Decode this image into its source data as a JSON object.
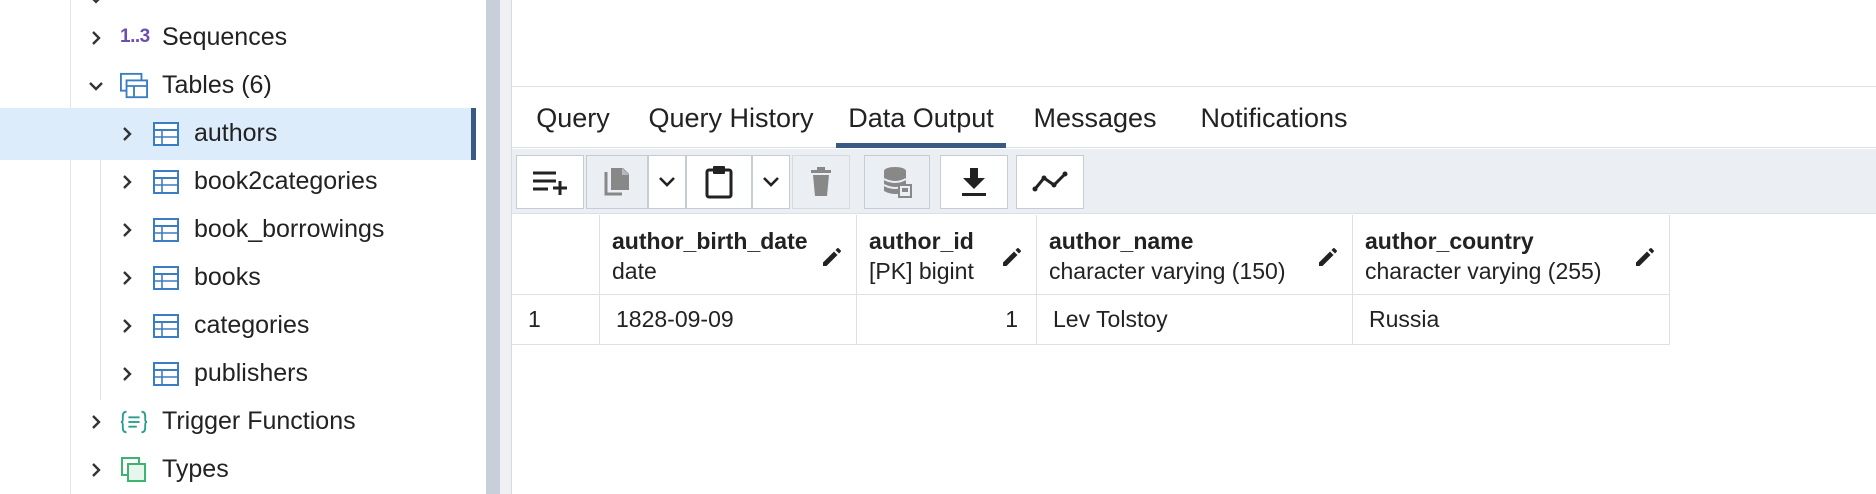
{
  "tree": {
    "items": [
      {
        "label": "Sequences",
        "icon": "sequence-icon",
        "icon_text": "1..3",
        "expanded": false
      },
      {
        "label": "Tables (6)",
        "icon": "tables-icon",
        "expanded": true
      },
      {
        "label": "authors",
        "icon": "table-icon",
        "expanded": false,
        "selected": true
      },
      {
        "label": "book2categories",
        "icon": "table-icon",
        "expanded": false
      },
      {
        "label": "book_borrowings",
        "icon": "table-icon",
        "expanded": false
      },
      {
        "label": "books",
        "icon": "table-icon",
        "expanded": false
      },
      {
        "label": "categories",
        "icon": "table-icon",
        "expanded": false
      },
      {
        "label": "publishers",
        "icon": "table-icon",
        "expanded": false
      },
      {
        "label": "Trigger Functions",
        "icon": "trigger-function-icon",
        "expanded": false
      },
      {
        "label": "Types",
        "icon": "types-icon",
        "expanded": false
      }
    ]
  },
  "tabs": [
    {
      "label": "Query",
      "active": false
    },
    {
      "label": "Query History",
      "active": false
    },
    {
      "label": "Data Output",
      "active": true
    },
    {
      "label": "Messages",
      "active": false
    },
    {
      "label": "Notifications",
      "active": false
    }
  ],
  "toolbar": {
    "buttons": [
      "add-row-icon",
      "copy-icon",
      "copy-options-icon",
      "paste-icon",
      "paste-options-icon",
      "delete-icon",
      "save-data-icon",
      "download-icon",
      "graph-visualiser-icon"
    ]
  },
  "grid": {
    "columns": [
      {
        "name": "author_birth_date",
        "type": "date"
      },
      {
        "name": "author_id",
        "type": "[PK] bigint"
      },
      {
        "name": "author_name",
        "type": "character varying (150)"
      },
      {
        "name": "author_country",
        "type": "character varying (255)"
      }
    ],
    "rows": [
      {
        "num": "1",
        "cells": [
          "1828-09-09",
          "1",
          "Lev Tolstoy",
          "Russia"
        ]
      }
    ]
  },
  "colors": {
    "accent": "#3a5a82",
    "selection": "#dcecfb",
    "toolbar_bg": "#ebeef3",
    "table_icon": "#3b7dc4",
    "trigger_icon": "#2a9d8f",
    "types_icon": "#3cb371",
    "sequence_icon": "#6a4fb3"
  }
}
